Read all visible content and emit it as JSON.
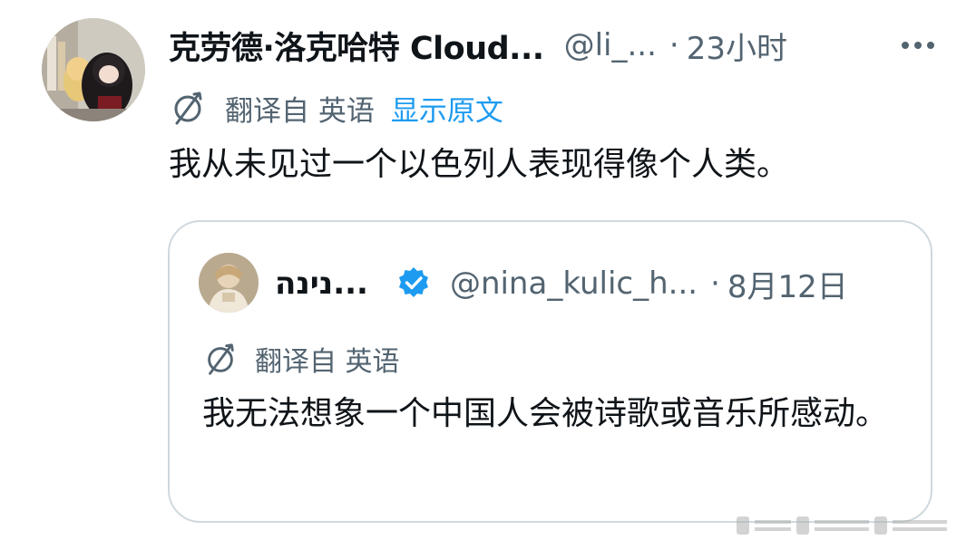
{
  "tweet": {
    "author_name": "克劳德·洛克哈特 Cloud...",
    "handle": "@li_...",
    "separator": "·",
    "time": "23小时",
    "translated_from": "翻译自 英语",
    "show_original": "显示原文",
    "text": "我从未见过一个以色列人表现得像个人类。",
    "more_icon": "more-horizontal-icon"
  },
  "quote": {
    "author_name": "נינה...",
    "verified_icon": "verified-badge-icon",
    "handle": "@nina_kulic_h...",
    "separator": "·",
    "time": "8月12日",
    "translated_from": "翻译自 英语",
    "text": "我无法想象一个中国人会被诗歌或音乐所感动。"
  },
  "colors": {
    "primary_text": "#0f1419",
    "secondary_text": "#536471",
    "link": "#1d9bf0",
    "border": "#cfd9de",
    "verified": "#1d9bf0"
  }
}
